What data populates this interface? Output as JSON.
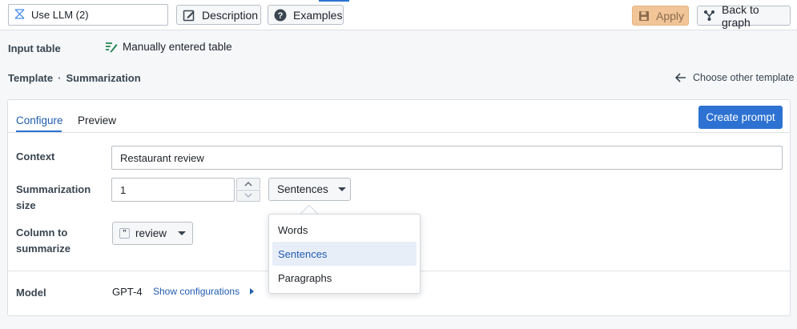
{
  "toolbar": {
    "name_value": "Use LLM (2)",
    "description_label": "Description",
    "examples_label": "Examples",
    "apply_label": "Apply",
    "back_label": "Back to graph"
  },
  "input_table": {
    "label": "Input table",
    "value": "Manually entered table"
  },
  "template": {
    "label": "Template",
    "separator": "·",
    "name": "Summarization",
    "choose_other": "Choose other template"
  },
  "tabs": [
    {
      "label": "Configure",
      "active": true
    },
    {
      "label": "Preview",
      "active": false
    }
  ],
  "create_prompt_label": "Create prompt",
  "form": {
    "context_label": "Context",
    "context_value": "Restaurant review",
    "size_label": "Summarization size",
    "size_value": "1",
    "size_unit": "Sentences",
    "column_label": "Column to summarize",
    "column_value": "review",
    "column_type_glyph": "”",
    "model_label": "Model",
    "model_value": "GPT-4",
    "show_config_label": "Show configurations"
  },
  "dropdown": {
    "options": [
      "Words",
      "Sentences",
      "Paragraphs"
    ],
    "selected": "Sentences"
  },
  "colors": {
    "accent": "#2d72d2",
    "apply_bg": "#f1c597",
    "table_icon": "#238551"
  }
}
